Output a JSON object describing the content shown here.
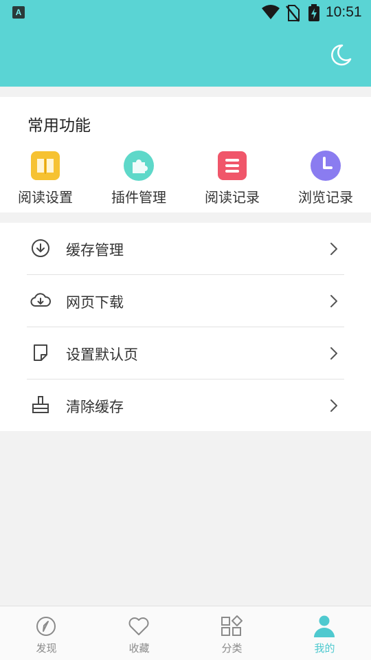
{
  "status_bar": {
    "time": "10:51",
    "app_icon_letter": "A"
  },
  "common": {
    "title": "常用功能",
    "items": [
      {
        "label": "阅读设置",
        "icon": "book-icon",
        "color": "#f6c232"
      },
      {
        "label": "插件管理",
        "icon": "puzzle-icon",
        "color": "#5ed8c9"
      },
      {
        "label": "阅读记录",
        "icon": "list-icon",
        "color": "#f0566a"
      },
      {
        "label": "浏览记录",
        "icon": "clock-icon",
        "color": "#8a7cf0"
      }
    ]
  },
  "menu": {
    "items": [
      {
        "label": "缓存管理",
        "icon": "download-circle-icon"
      },
      {
        "label": "网页下载",
        "icon": "cloud-download-icon"
      },
      {
        "label": "设置默认页",
        "icon": "page-icon"
      },
      {
        "label": "清除缓存",
        "icon": "broom-icon"
      }
    ]
  },
  "bottom_nav": {
    "items": [
      {
        "label": "发现",
        "icon": "compass-icon",
        "active": false
      },
      {
        "label": "收藏",
        "icon": "heart-icon",
        "active": false
      },
      {
        "label": "分类",
        "icon": "category-icon",
        "active": false
      },
      {
        "label": "我的",
        "icon": "user-icon",
        "active": true
      }
    ],
    "active_color": "#4fc9cf",
    "inactive_color": "#8a8a8a"
  },
  "theme": {
    "header_color": "#5ad4d4",
    "background": "#f2f2f2"
  }
}
